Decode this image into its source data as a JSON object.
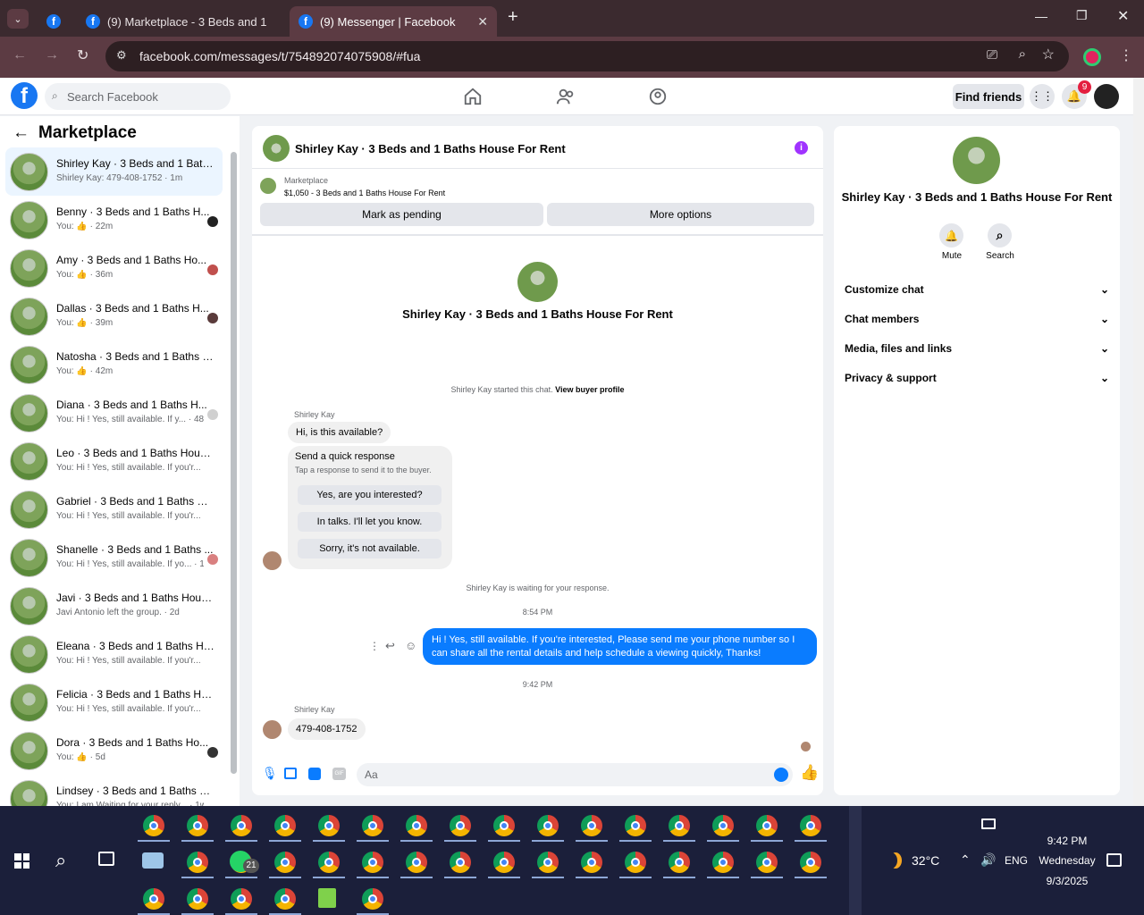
{
  "browser": {
    "tabs": [
      {
        "label": "(9) Marketplace - 3 Beds and 1"
      },
      {
        "label": "(9) Messenger | Facebook"
      }
    ],
    "new_tab": "+",
    "url": "facebook.com/messages/t/754892074075908/#fua"
  },
  "fb": {
    "search_placeholder": "Search Facebook",
    "find_friends": "Find friends",
    "notif_count": "9",
    "logo": "f"
  },
  "left": {
    "title": "Marketplace",
    "conversations": [
      {
        "name": "Shirley Kay · 3 Beds and 1 Baths...",
        "preview": "Shirley Kay: 479-408-1752 · 1m"
      },
      {
        "name": "Benny · 3 Beds and 1 Baths H...",
        "preview": "You: 👍 · 22m"
      },
      {
        "name": "Amy · 3 Beds and 1 Baths Ho...",
        "preview": "You: 👍 · 36m"
      },
      {
        "name": "Dallas · 3 Beds and 1 Baths H...",
        "preview": "You: 👍 · 39m"
      },
      {
        "name": "Natosha · 3 Beds and 1 Baths H...",
        "preview": "You: 👍 · 42m"
      },
      {
        "name": "Diana · 3 Beds and 1 Baths H...",
        "preview": "You: Hi ! Yes, still available. If y... · 48m"
      },
      {
        "name": "Leo · 3 Beds and 1 Baths House ...",
        "preview": "You: Hi ! Yes, still available. If you'r... · 1d"
      },
      {
        "name": "Gabriel · 3 Beds and 1 Baths Ho...",
        "preview": "You: Hi ! Yes, still available. If you'r... · 1d"
      },
      {
        "name": "Shanelle · 3 Beds and 1 Baths ...",
        "preview": "You: Hi ! Yes, still available. If yo... · 1d"
      },
      {
        "name": "Javi · 3 Beds and 1 Baths House ...",
        "preview": "Javi Antonio left the group. · 2d"
      },
      {
        "name": "Eleana · 3 Beds and 1 Baths Hou...",
        "preview": "You: Hi ! Yes, still available. If you'r... · 4d"
      },
      {
        "name": "Felicia · 3 Beds and 1 Baths Hou...",
        "preview": "You: Hi ! Yes, still available. If you'r... · 4d"
      },
      {
        "name": "Dora · 3 Beds and 1 Baths Ho...",
        "preview": "You: 👍 · 5d"
      },
      {
        "name": "Lindsey · 3 Beds and 1 Baths Ho...",
        "preview": "You: I am Waiting for your reply... · 1w"
      }
    ]
  },
  "chat": {
    "header_title": "Shirley Kay · 3 Beds and 1 Baths House For Rent",
    "listing_source": "Marketplace",
    "listing_title": "$1,050 - 3 Beds and 1 Baths House For Rent",
    "mark_pending": "Mark as pending",
    "more_options": "More options",
    "center_title": "Shirley Kay · 3 Beds and 1 Baths House For Rent",
    "started_text": "Shirley Kay started this chat.",
    "view_buyer": "View buyer profile",
    "sender1": "Shirley Kay",
    "msg1": "Hi, is this available?",
    "quick_title": "Send a quick response",
    "quick_sub": "Tap a response to send it to the buyer.",
    "quick_responses": [
      "Yes, are you interested?",
      "In talks. I'll let you know.",
      "Sorry, it's not available."
    ],
    "waiting": "Shirley Kay is waiting for your response.",
    "time1": "8:54 PM",
    "my_msg": "Hi ! Yes, still available. If you're interested, Please send me your phone number so I can share all the rental details and help schedule a viewing quickly, Thanks!",
    "time2": "9:42 PM",
    "sender2": "Shirley Kay",
    "msg2": "479-408-1752",
    "composer_placeholder": "Aa"
  },
  "right": {
    "title": "Shirley Kay · 3 Beds and 1 Baths House For Rent",
    "mute": "Mute",
    "search": "Search",
    "sections": [
      "Customize chat",
      "Chat members",
      "Media, files and links",
      "Privacy & support"
    ]
  },
  "taskbar": {
    "temp": "32°C",
    "lang": "ENG",
    "time": "9:42 PM",
    "day": "Wednesday",
    "date": "9/3/2025",
    "whatsapp_badge": "21"
  }
}
